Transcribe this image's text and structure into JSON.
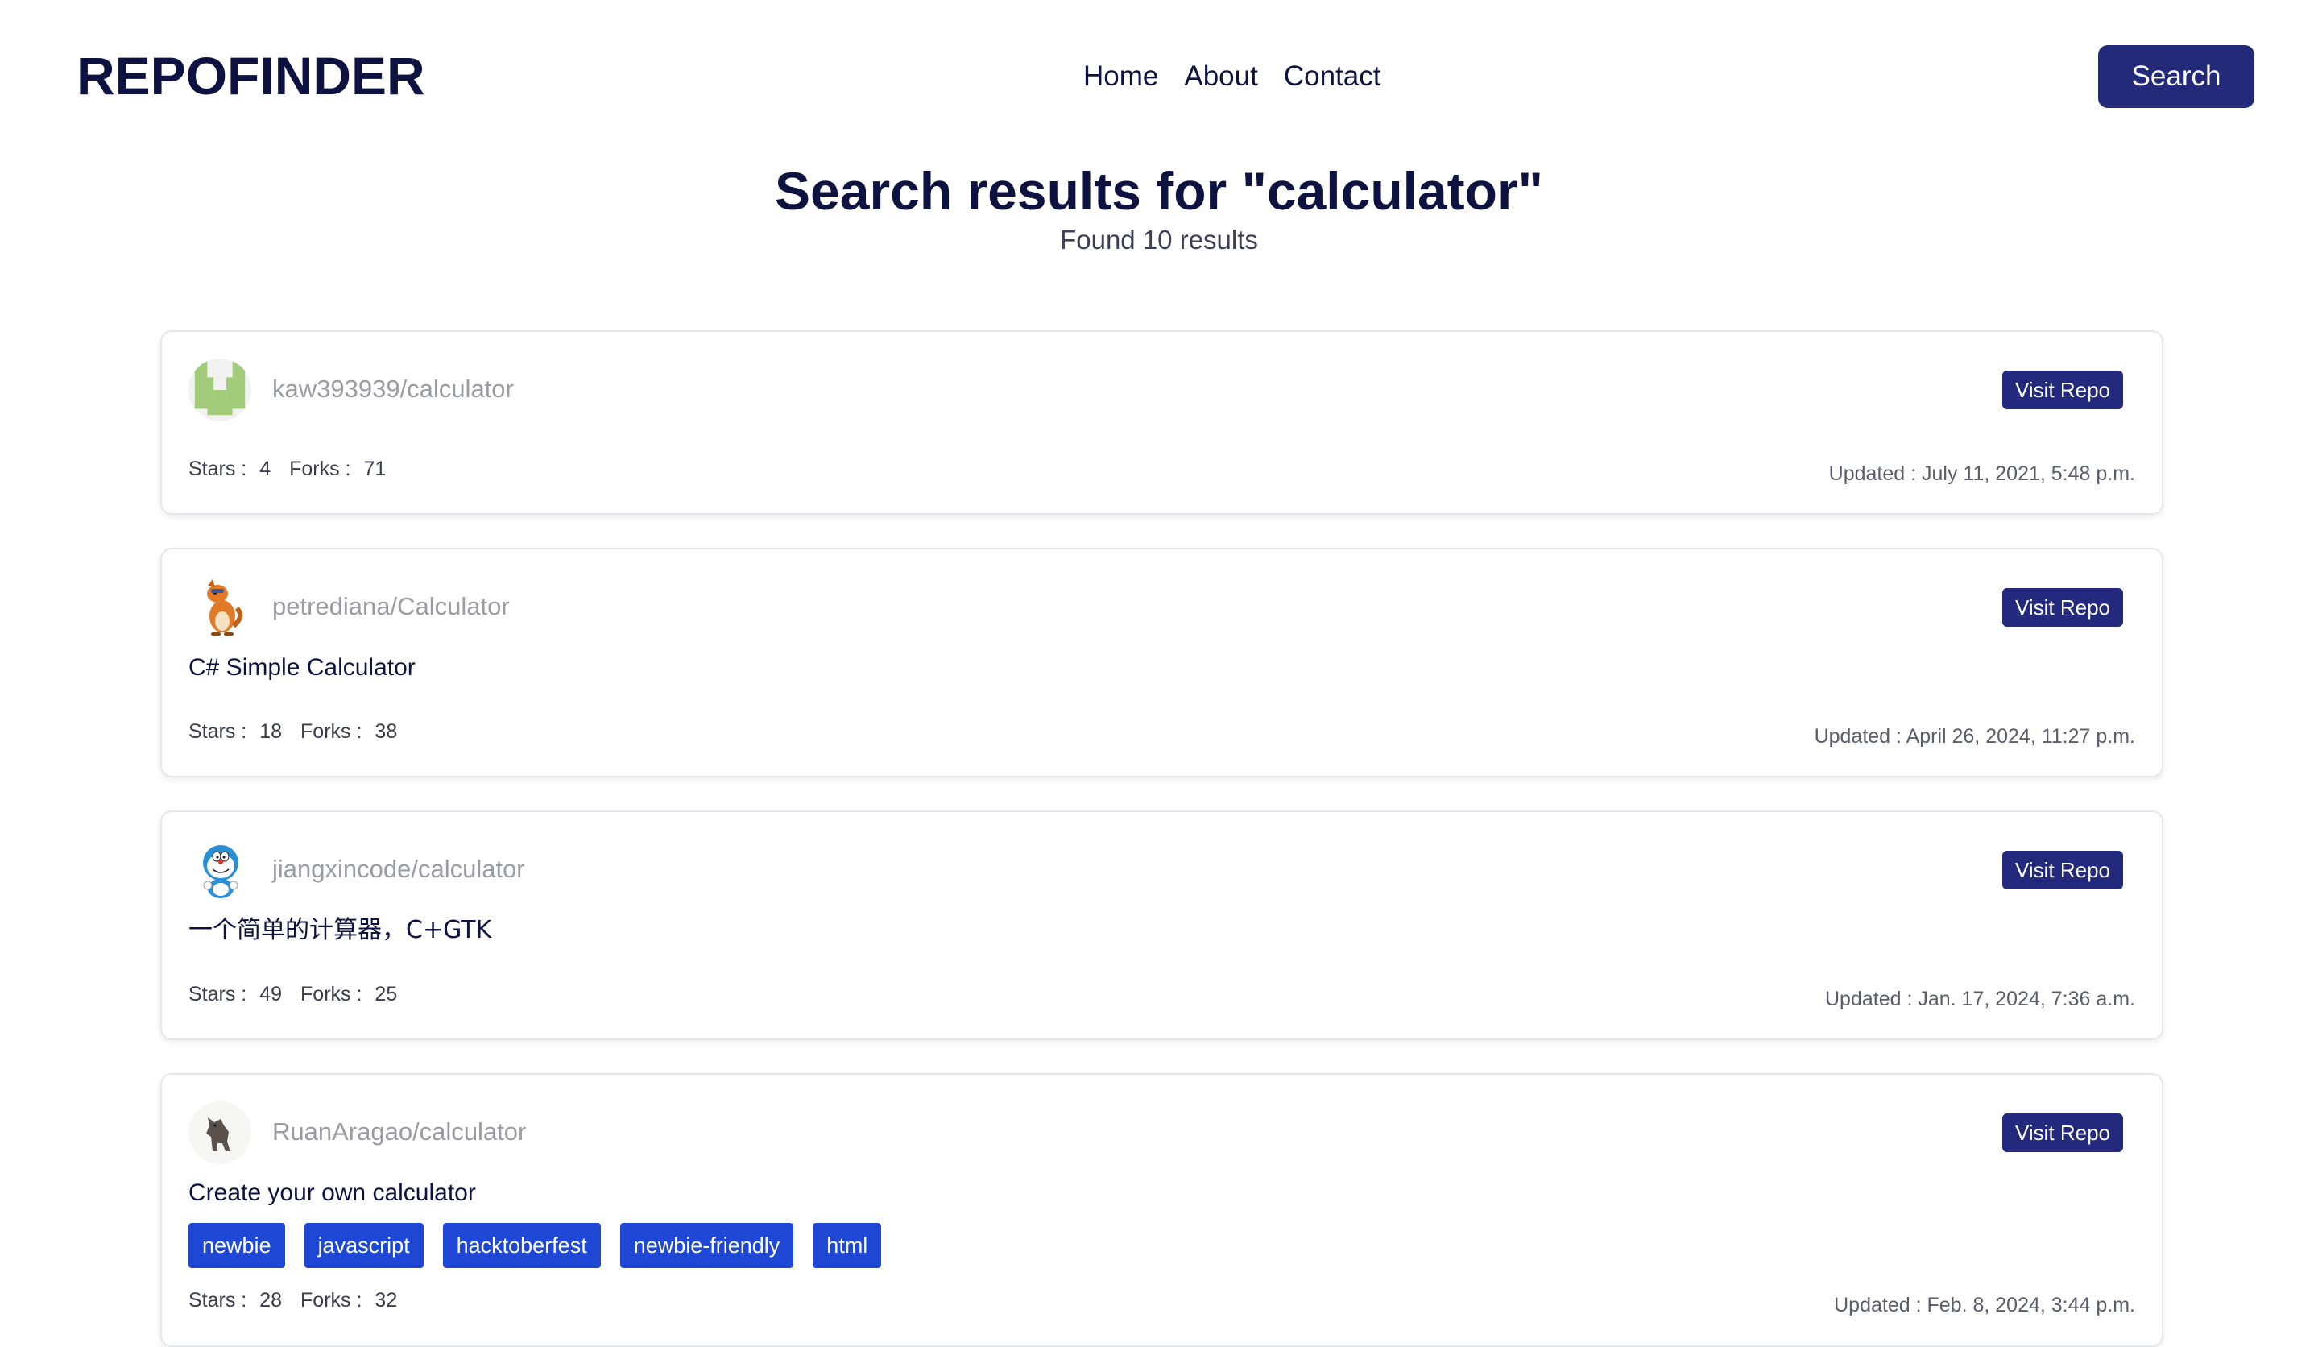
{
  "header": {
    "logo": "REPOFINDER",
    "nav": [
      "Home",
      "About",
      "Contact"
    ],
    "search_button": "Search"
  },
  "results_header": {
    "title": "Search results for \"calculator\"",
    "count_text": "Found 10 results"
  },
  "labels": {
    "visit": "Visit Repo",
    "stars_label": "Stars :",
    "forks_label": "Forks :",
    "updated_label": "Updated :"
  },
  "repos": [
    {
      "name": "kaw393939/calculator",
      "description": "",
      "stars": "4",
      "forks": "71",
      "updated": "July 11, 2021, 5:48 p.m.",
      "tags": [],
      "avatar_icon": "identicon-avatar"
    },
    {
      "name": "petrediana/Calculator",
      "description": "C# Simple Calculator",
      "stars": "18",
      "forks": "38",
      "updated": "April 26, 2024, 11:27 p.m.",
      "tags": [],
      "avatar_icon": "cartoon-fox-avatar"
    },
    {
      "name": "jiangxincode/calculator",
      "description": "一个简单的计算器，C+GTK",
      "stars": "49",
      "forks": "25",
      "updated": "Jan. 17, 2024, 7:36 a.m.",
      "tags": [],
      "avatar_icon": "doraemon-avatar"
    },
    {
      "name": "RuanAragao/calculator",
      "description": "Create your own calculator",
      "stars": "28",
      "forks": "32",
      "updated": "Feb. 8, 2024, 3:44 p.m.",
      "tags": [
        "newbie",
        "javascript",
        "hacktoberfest",
        "newbie-friendly",
        "html"
      ],
      "avatar_icon": "dog-figure-avatar"
    }
  ],
  "colors": {
    "navy": "#0e1240",
    "button": "#232a7d",
    "tag": "#1f47d6"
  }
}
